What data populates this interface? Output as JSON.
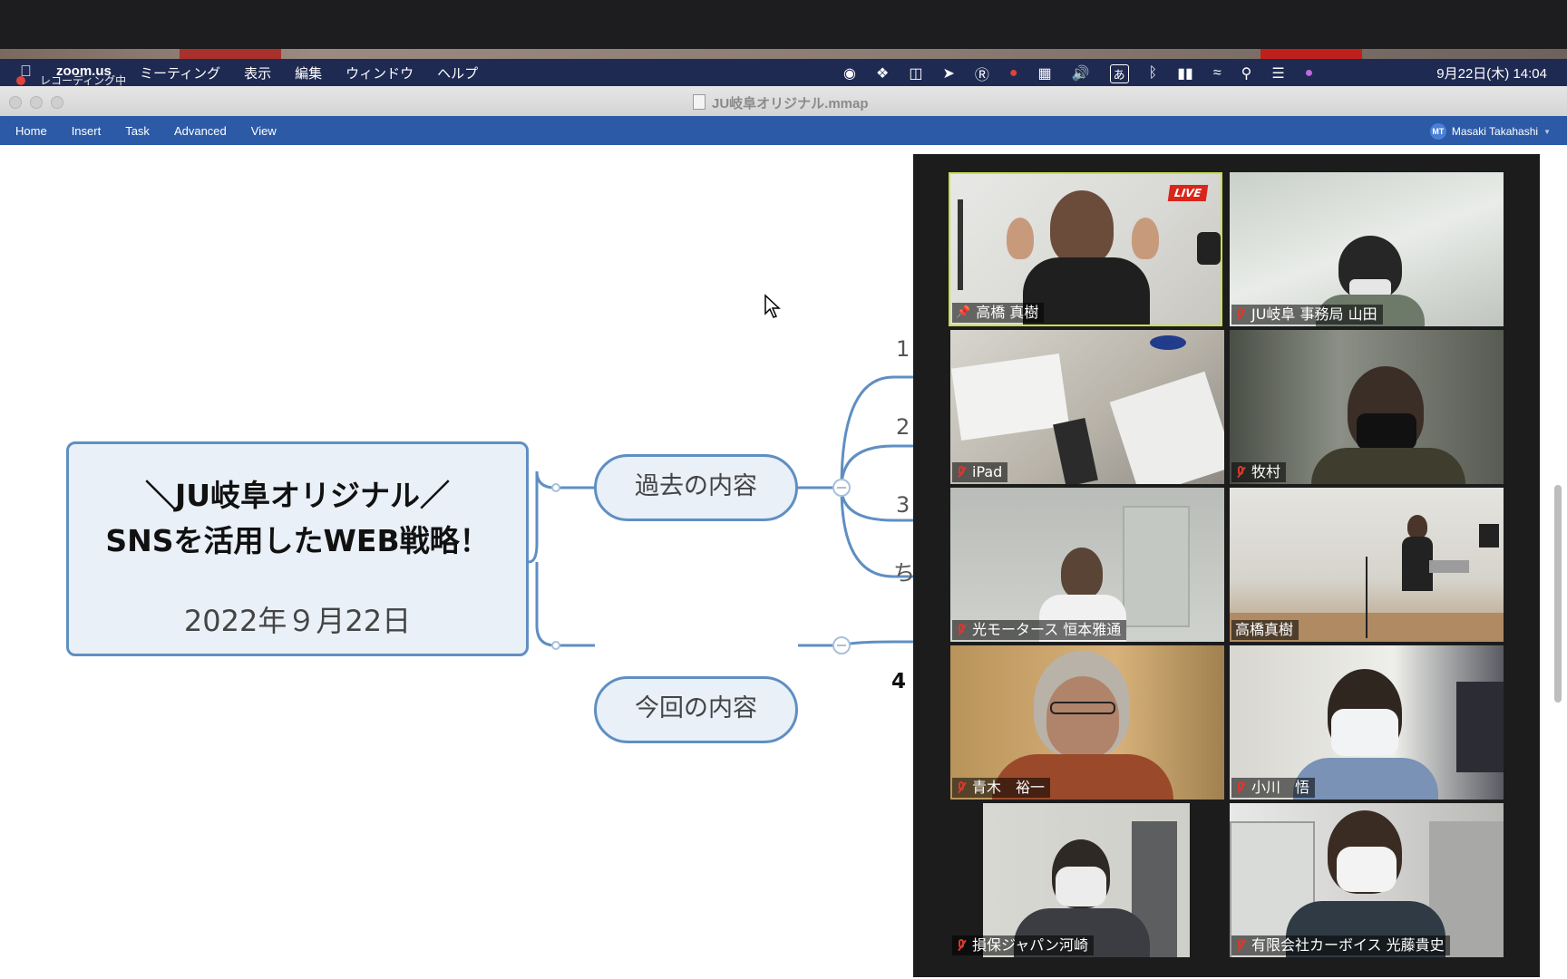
{
  "menubar": {
    "recording_label": "レコーディング中",
    "app_name": "zoom.us",
    "menus": [
      "ミーティング",
      "表示",
      "編集",
      "ウィンドウ",
      "ヘルプ"
    ],
    "ime_label": "あ",
    "clock": "9月22日(木) 14:04"
  },
  "window": {
    "title": "JU岐阜オリジナル.mmap"
  },
  "ribbon": {
    "tabs": [
      "Home",
      "Insert",
      "Task",
      "Advanced",
      "View"
    ],
    "user_initials": "MT",
    "user_name": "Masaki Takahashi"
  },
  "mindmap": {
    "central_title_line1": "＼JU岐阜オリジナル／",
    "central_title_line2": "SNSを活用したWEB戦略！",
    "central_date": "2022年９月22日",
    "branch_past": "過去の内容",
    "branch_current": "今回の内容",
    "sub_labels": [
      "1",
      "2",
      "3",
      "ち"
    ],
    "current_sub_label": "4"
  },
  "gallery": {
    "participants": [
      {
        "name": "高橋 真樹",
        "muted": false,
        "pinned": true,
        "live": "LIVE",
        "active": true
      },
      {
        "name": "JU岐阜 事務局 山田",
        "muted": true
      },
      {
        "name": "iPad",
        "muted": true
      },
      {
        "name": "牧村",
        "muted": true
      },
      {
        "name": "光モータース 恒本雅通",
        "muted": true
      },
      {
        "name": "高橋真樹",
        "muted": false
      },
      {
        "name": "青木　裕一",
        "muted": true
      },
      {
        "name": "小川　悟",
        "muted": true
      },
      {
        "name": "損保ジャパン河崎",
        "muted": true
      },
      {
        "name": "有限会社カーボイス 光藤貴史",
        "muted": true
      }
    ]
  }
}
